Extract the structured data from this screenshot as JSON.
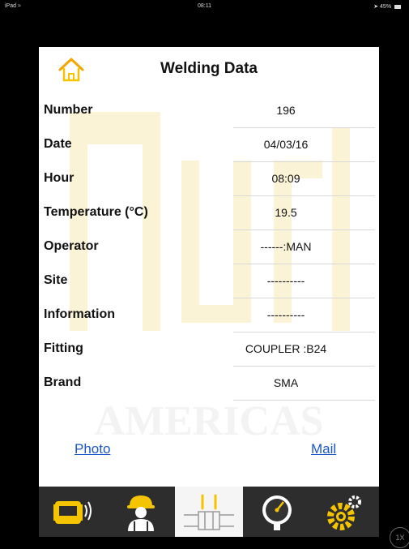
{
  "status_bar": {
    "device": "iPad",
    "wifi_icon": "wifi-icon",
    "time": "08:11",
    "battery": "45%"
  },
  "header": {
    "title": "Welding Data",
    "home_icon": "home-icon"
  },
  "watermark": {
    "text": "AMERICAS"
  },
  "rows": [
    {
      "label": "Number",
      "value": "196"
    },
    {
      "label": "Date",
      "value": "04/03/16"
    },
    {
      "label": "Hour",
      "value": "08:09"
    },
    {
      "label": "Temperature (°C)",
      "value": "19.5"
    },
    {
      "label": "Operator",
      "value": "------:MAN"
    },
    {
      "label": "Site",
      "value": "----------"
    },
    {
      "label": "Information",
      "value": "----------"
    },
    {
      "label": "Fitting",
      "value": "COUPLER  :B24"
    },
    {
      "label": "Brand",
      "value": "SMA"
    }
  ],
  "links": {
    "photo": "Photo",
    "mail": "Mail"
  },
  "tabbar": {
    "tabs": [
      {
        "icon": "welding-machine-icon",
        "active": false
      },
      {
        "icon": "worker-icon",
        "active": false
      },
      {
        "icon": "fitting-icon",
        "active": true
      },
      {
        "icon": "gauge-icon",
        "active": false
      },
      {
        "icon": "settings-gear-icon",
        "active": false
      }
    ],
    "accent": "#f5c400"
  },
  "zoom_badge": "1X"
}
